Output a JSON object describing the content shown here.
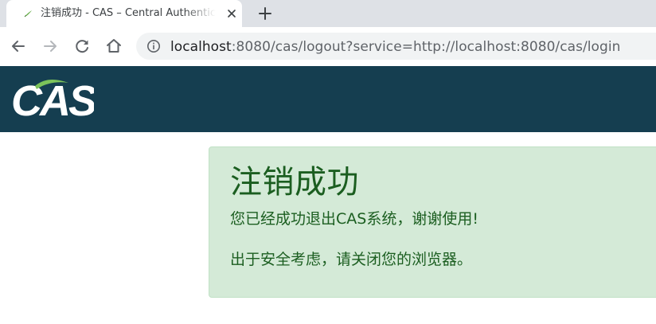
{
  "browser": {
    "tab": {
      "title": "注销成功 - CAS – Central Authentication Service",
      "favicon": "cas-leaf-icon"
    },
    "address_bar": {
      "host": "localhost",
      "rest": ":8080/cas/logout?service=http://localhost:8080/cas/login"
    },
    "icons": {
      "close": "close-icon",
      "new_tab": "plus-icon",
      "back": "back-arrow-icon",
      "forward": "forward-arrow-icon",
      "reload": "reload-icon",
      "home": "home-icon",
      "site_info": "info-icon"
    }
  },
  "page": {
    "header": {
      "logo": "CAS",
      "background": "#153e50"
    },
    "notice": {
      "title": "注销成功",
      "line1": "您已经成功退出CAS系统，谢谢使用!",
      "line2": "出于安全考虑，请关闭您的浏览器。",
      "background": "#d4ead7",
      "text_color": "#1b5e20"
    }
  }
}
